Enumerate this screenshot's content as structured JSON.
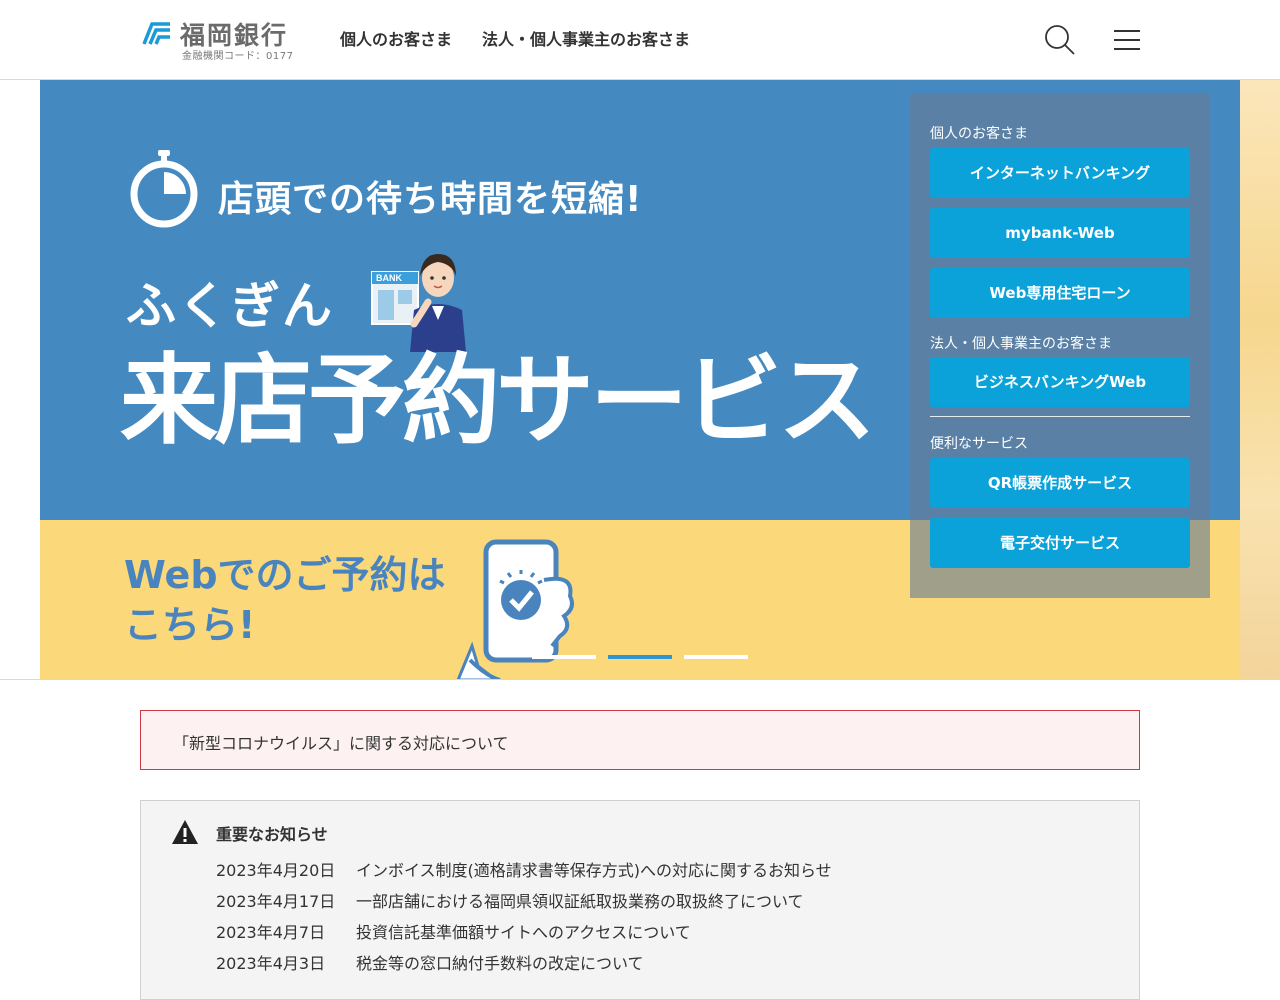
{
  "header": {
    "logo_title": "福岡銀行",
    "logo_code": "金融機関コード：0177",
    "nav": {
      "personal": "個人のお客さま",
      "business": "法人・個人事業主のお客さま"
    },
    "icons": [
      "search-icon",
      "menu-icon"
    ]
  },
  "hero": {
    "heading": "店頭での待ち時間を短縮!",
    "brand": "ふくぎん",
    "service": "来店予約サービス",
    "illustration_sign": "BANK",
    "cta_line1": "Webでのご予約は",
    "cta_line2": "こちら!",
    "slider": {
      "count": 3,
      "active_index": 1
    },
    "colors": {
      "blue": "#448ac0",
      "yellow": "#fbd97a",
      "cta_text": "#4a84bf"
    }
  },
  "quick_links": {
    "personal_caption": "個人のお客さま",
    "personal": [
      "インターネットバンキング",
      "mybank-Web",
      "Web専用住宅ローン"
    ],
    "business_caption": "法人・個人事業主のお客さま",
    "business": [
      "ビジネスバンキングWeb"
    ],
    "services_caption": "便利なサービス",
    "services": [
      "QR帳票作成サービス",
      "電子交付サービス"
    ],
    "button_color": "#0aa2d9"
  },
  "notice": {
    "text": "「新型コロナウイルス」に関する対応について",
    "border_color": "#cf3a45"
  },
  "important_news": {
    "title": "重要なお知らせ",
    "icon": "warning-icon",
    "items": [
      {
        "date": "2023年4月20日",
        "text": "インボイス制度(適格請求書等保存方式)への対応に関するお知らせ"
      },
      {
        "date": "2023年4月17日",
        "text": "一部店舗における福岡県領収証紙取扱業務の取扱終了について"
      },
      {
        "date": "2023年4月7日",
        "text": "投資信託基準価額サイトへのアクセスについて"
      },
      {
        "date": "2023年4月3日",
        "text": "税金等の窓口納付手数料の改定について"
      }
    ]
  }
}
